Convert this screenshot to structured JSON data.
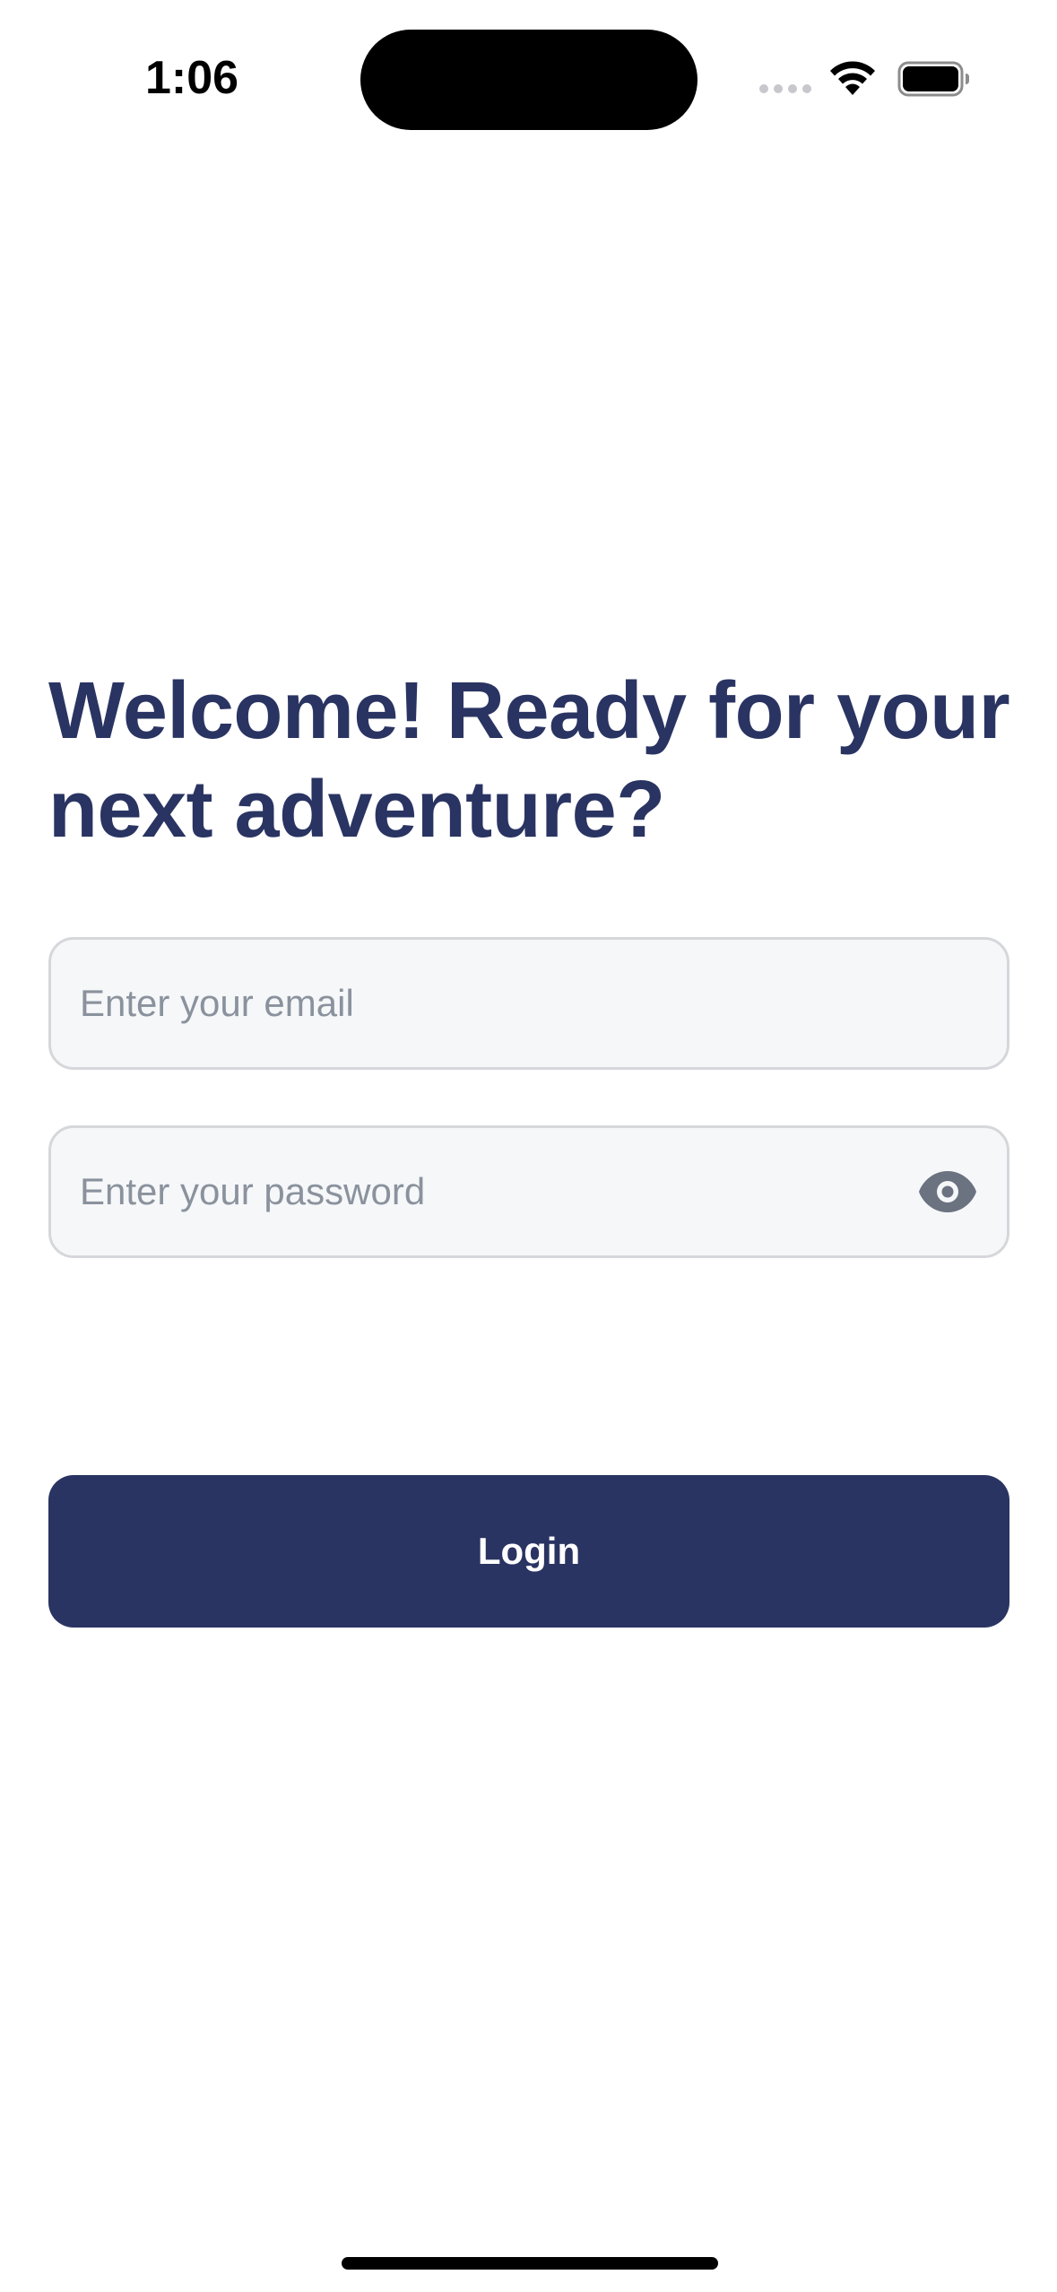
{
  "status_bar": {
    "time": "1:06",
    "icons": [
      "signal-dots-icon",
      "wifi-icon",
      "battery-icon"
    ]
  },
  "login": {
    "title": "Welcome! Ready for your next adventure?",
    "email_placeholder": "Enter your email",
    "email_value": "",
    "password_placeholder": "Enter your password",
    "password_value": "",
    "password_toggle_icon": "eye-icon",
    "login_label": "Login"
  },
  "colors": {
    "primary": "#2a3462",
    "input_background": "#f6f7f9",
    "input_border": "#d5d7db",
    "placeholder": "#8a929d",
    "icon_gray": "#6b7280"
  }
}
